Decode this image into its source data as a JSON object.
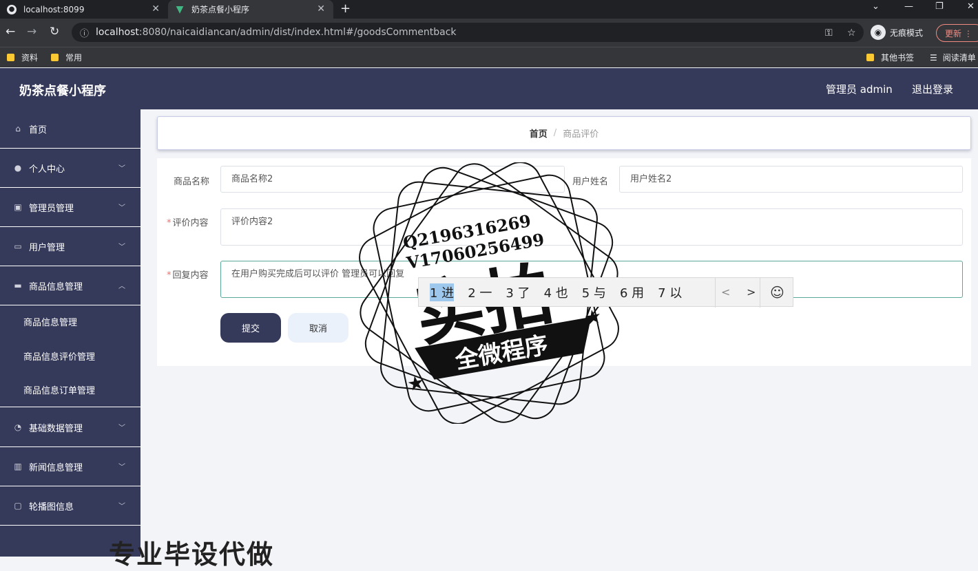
{
  "browser": {
    "tabs": [
      {
        "title": "localhost:8099"
      },
      {
        "title": "奶茶点餐小程序"
      }
    ],
    "url_host": "localhost",
    "url_rest": ":8080/naicaidiancan/admin/dist/index.html#/goodsCommentback",
    "incognito_label": "无痕模式",
    "update_label": "更新",
    "bookmarks": [
      "资料",
      "常用"
    ],
    "bookmarks_right": [
      "其他书签",
      "阅读清单"
    ]
  },
  "app": {
    "title": "奶茶点餐小程序",
    "user_label": "管理员 admin",
    "logout_label": "退出登录"
  },
  "sidebar": {
    "items": [
      {
        "label": "首页",
        "icon": "home-icon"
      },
      {
        "label": "个人中心",
        "icon": "user-icon"
      },
      {
        "label": "管理员管理",
        "icon": "clipboard-icon"
      },
      {
        "label": "用户管理",
        "icon": "id-card-icon"
      },
      {
        "label": "商品信息管理",
        "icon": "briefcase-icon"
      },
      {
        "label": "基础数据管理",
        "icon": "gauge-icon"
      },
      {
        "label": "新闻信息管理",
        "icon": "book-icon"
      },
      {
        "label": "轮播图信息",
        "icon": "chat-icon"
      }
    ],
    "sub_items": [
      "商品信息管理",
      "商品信息评价管理",
      "商品信息订单管理"
    ]
  },
  "breadcrumb": {
    "home": "首页",
    "separator": "/",
    "current": "商品评价"
  },
  "form": {
    "goods_name_label": "商品名称",
    "goods_name_value": "商品名称2",
    "user_name_label": "用户姓名",
    "user_name_value": "用户姓名2",
    "comment_label": "评价内容",
    "comment_value": "评价内容2",
    "reply_label": "回复内容",
    "reply_value": "在用户购买完成后可以评价  管理员可以回复",
    "required_mark": "*",
    "submit_label": "提交",
    "cancel_label": "取消"
  },
  "ime": {
    "candidates": [
      "1 进",
      "2 一",
      "3 了",
      "4 也",
      "5 与",
      "6 用",
      "7 以"
    ],
    "prev": "<",
    "next": ">",
    "emoji": "☺"
  },
  "stamp": {
    "line1": "Q2196316269",
    "line2": "V17060256499",
    "big": "实拍",
    "ribbon": "全微程序"
  },
  "watermark_bottom": "专业毕设代做",
  "colors": {
    "sidebar_bg": "#363a5a",
    "accent_focus": "#5aa89a",
    "required": "#f56c6c"
  }
}
